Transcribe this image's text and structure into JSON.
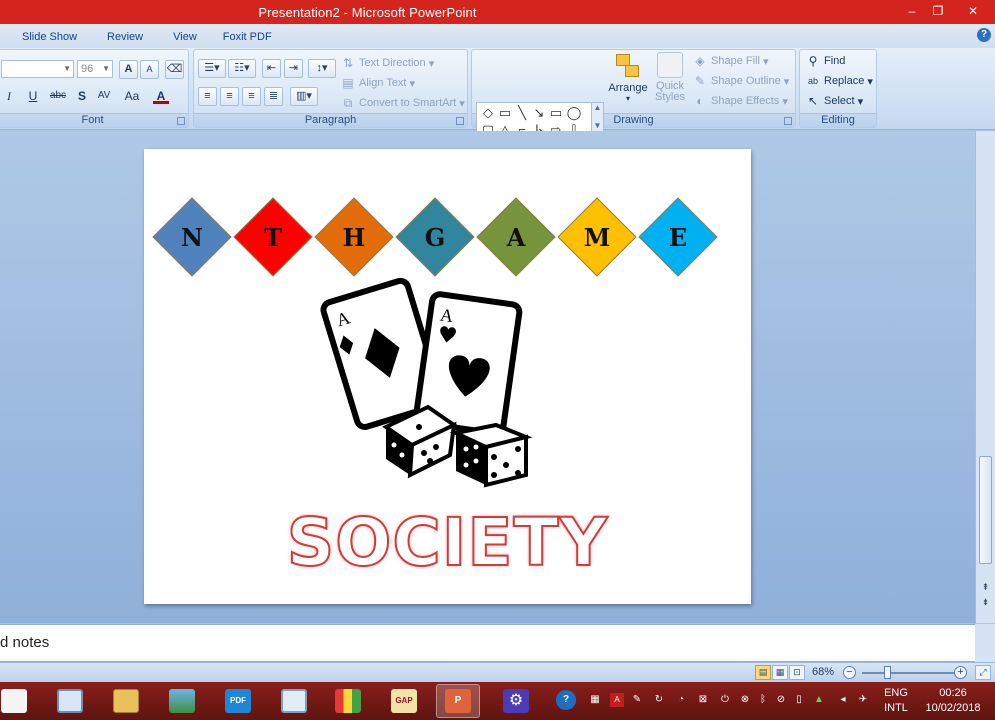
{
  "window": {
    "title": "Presentation2 - Microsoft PowerPoint",
    "minimize_glyph": "–",
    "restore_glyph": "❐",
    "close_glyph": "✕"
  },
  "tabs": [
    "Slide Show",
    "Review",
    "View",
    "Foxit PDF"
  ],
  "ribbon": {
    "font": {
      "label": "Font",
      "size_value": "96",
      "grow_label": "A",
      "shrink_label": "A",
      "italic": "I",
      "underline": "U",
      "strike": "abc",
      "shadow": "S",
      "spacing": "AV",
      "case": "Aa",
      "color": "A"
    },
    "paragraph": {
      "label": "Paragraph",
      "text_direction": "Text Direction",
      "align_text": "Align Text",
      "convert_smartart": "Convert to SmartArt"
    },
    "drawing": {
      "label": "Drawing",
      "arrange": "Arrange",
      "quick_styles_line1": "Quick",
      "quick_styles_line2": "Styles",
      "shape_fill": "Shape Fill",
      "shape_outline": "Shape Outline",
      "shape_effects": "Shape Effects"
    },
    "editing": {
      "label": "Editing",
      "find": "Find",
      "replace": "Replace",
      "select": "Select"
    }
  },
  "slide": {
    "letters": [
      "N",
      "T",
      "H",
      "G",
      "A",
      "M",
      "E"
    ],
    "diamond_colors": [
      "#4f81bd",
      "#ff0000",
      "#e36c0a",
      "#31859c",
      "#77933c",
      "#ffc000",
      "#00b0f0"
    ],
    "card_corner": "A",
    "heading": "SOCIETY"
  },
  "notes": {
    "text": "d notes"
  },
  "status": {
    "zoom": "68%"
  },
  "taskbar": {
    "tray": {
      "lang_top": "ENG",
      "lang_bottom": "INTL",
      "time": "00:26",
      "date": "10/02/2018"
    }
  }
}
